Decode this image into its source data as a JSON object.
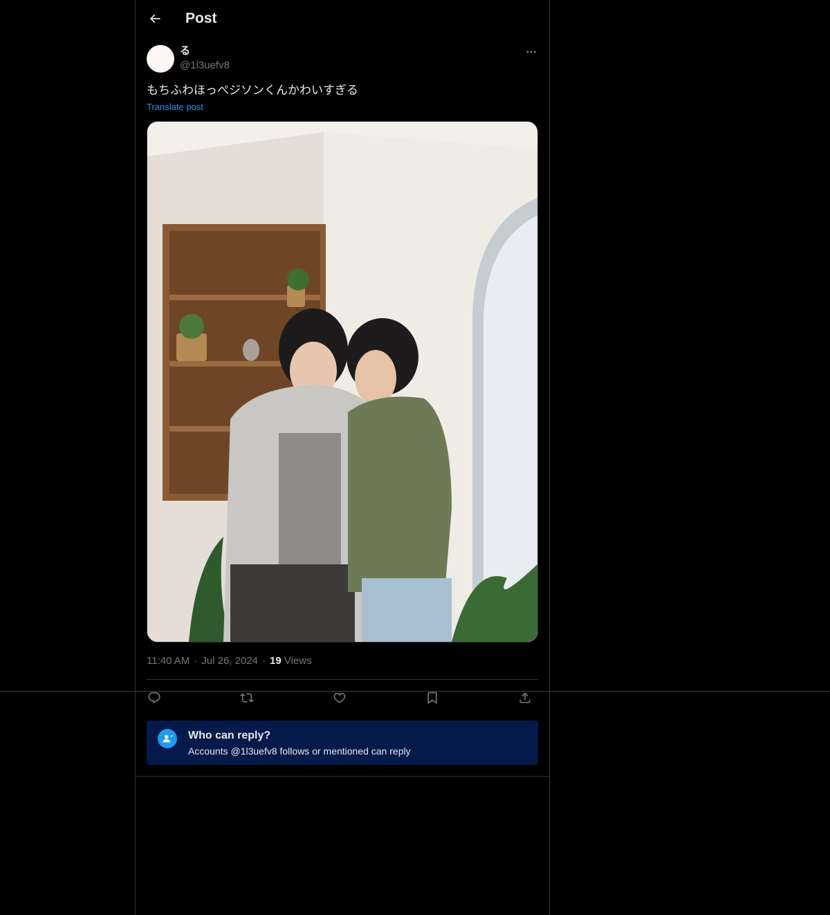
{
  "header": {
    "title": "Post"
  },
  "author": {
    "display_name": "る",
    "handle": "@1l3uefv8"
  },
  "post": {
    "text": "もちふわほっぺジソンくんかわいすぎる",
    "translate_label": "Translate post",
    "time": "11:40 AM",
    "separator": "·",
    "date": "Jul 26, 2024",
    "views_count": "19",
    "views_label": "Views"
  },
  "actions": {
    "icons": [
      "reply-icon",
      "repost-icon",
      "like-icon",
      "bookmark-icon",
      "share-icon"
    ]
  },
  "reply_notice": {
    "title": "Who can reply?",
    "description": "Accounts @1l3uefv8 follows or mentioned can reply"
  },
  "colors": {
    "background": "#000000",
    "text_primary": "#e7e9ea",
    "text_secondary": "#71767b",
    "accent": "#1d9bf0",
    "border": "#2f3336",
    "reply_box_bg": "#031a4a"
  }
}
